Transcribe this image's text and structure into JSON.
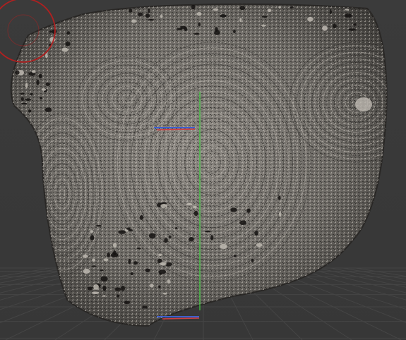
{
  "viewport": {
    "background_color": "#393939",
    "grid_line_color": "#454545",
    "mesh_base_color": "#7a7670",
    "mesh_shade_color": "#2a2826",
    "mesh_highlight_color": "#bdb8b0",
    "axis_x_color": "#d04040",
    "axis_y_color": "#40c040",
    "axis_z_color": "#4060d0",
    "brush_cursor_color": "#b02020"
  },
  "tools": {
    "brush_cursor_icon": "brush-circle-icon",
    "transform_gizmo_icon": "axis-gizmo-icon",
    "ground_grid_icon": "ground-grid"
  }
}
